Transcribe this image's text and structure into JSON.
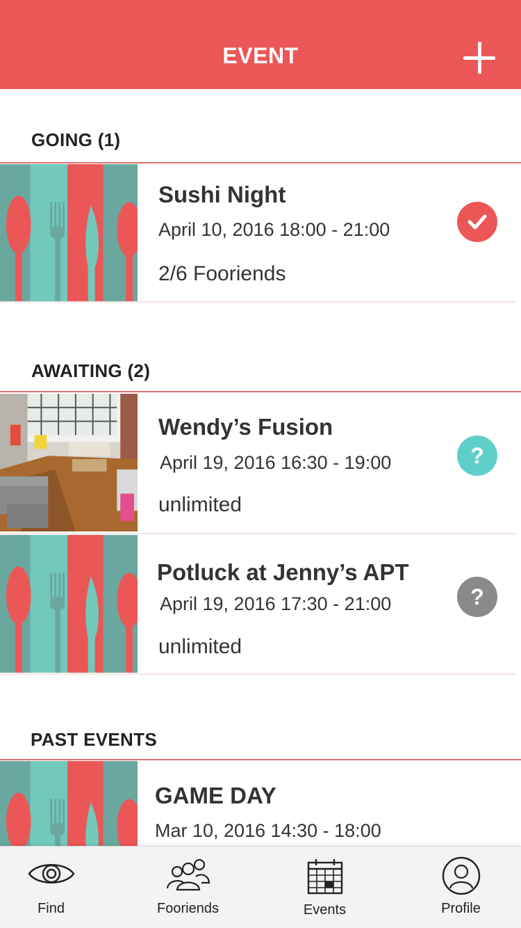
{
  "header": {
    "title": "EVENT",
    "add_icon": "plus-icon"
  },
  "sections": {
    "going": {
      "title": "GOING (1)",
      "events": [
        {
          "name": "Sushi Night",
          "datetime": "April 10, 2016  18:00 - 21:00",
          "capacity": "2/6 Fooriends",
          "status_icon": "check-circle-icon",
          "thumbnail": "cutlery-pattern"
        }
      ]
    },
    "awaiting": {
      "title": "AWAITING (2)",
      "events": [
        {
          "name": "Wendy’s Fusion",
          "datetime": "April 19, 2016  16:30 - 19:00",
          "capacity": "unlimited",
          "status_icon": "question-circle-icon",
          "thumbnail": "loft-interior-photo"
        },
        {
          "name": "Potluck at Jenny’s APT",
          "datetime": "April 19, 2016  17:30 - 21:00",
          "capacity": "unlimited",
          "status_icon": "question-circle-icon",
          "thumbnail": "cutlery-pattern"
        }
      ]
    },
    "past": {
      "title": "PAST EVENTS",
      "events": [
        {
          "name": "GAME DAY",
          "datetime": "Mar 10, 2016  14:30 - 18:00",
          "thumbnail": "cutlery-pattern"
        }
      ]
    }
  },
  "status_marks": {
    "check": "✓",
    "question": "?"
  },
  "tabbar": {
    "tabs": [
      {
        "label": "Find",
        "icon": "eye-icon"
      },
      {
        "label": "Fooriends",
        "icon": "people-icon"
      },
      {
        "label": "Events",
        "icon": "calendar-icon"
      },
      {
        "label": "Profile",
        "icon": "user-circle-icon"
      }
    ]
  },
  "colors": {
    "accent": "#eb5757",
    "teal": "#72c9bb",
    "awaiting": "#5fcfc8",
    "pending": "#8a8a8a"
  }
}
